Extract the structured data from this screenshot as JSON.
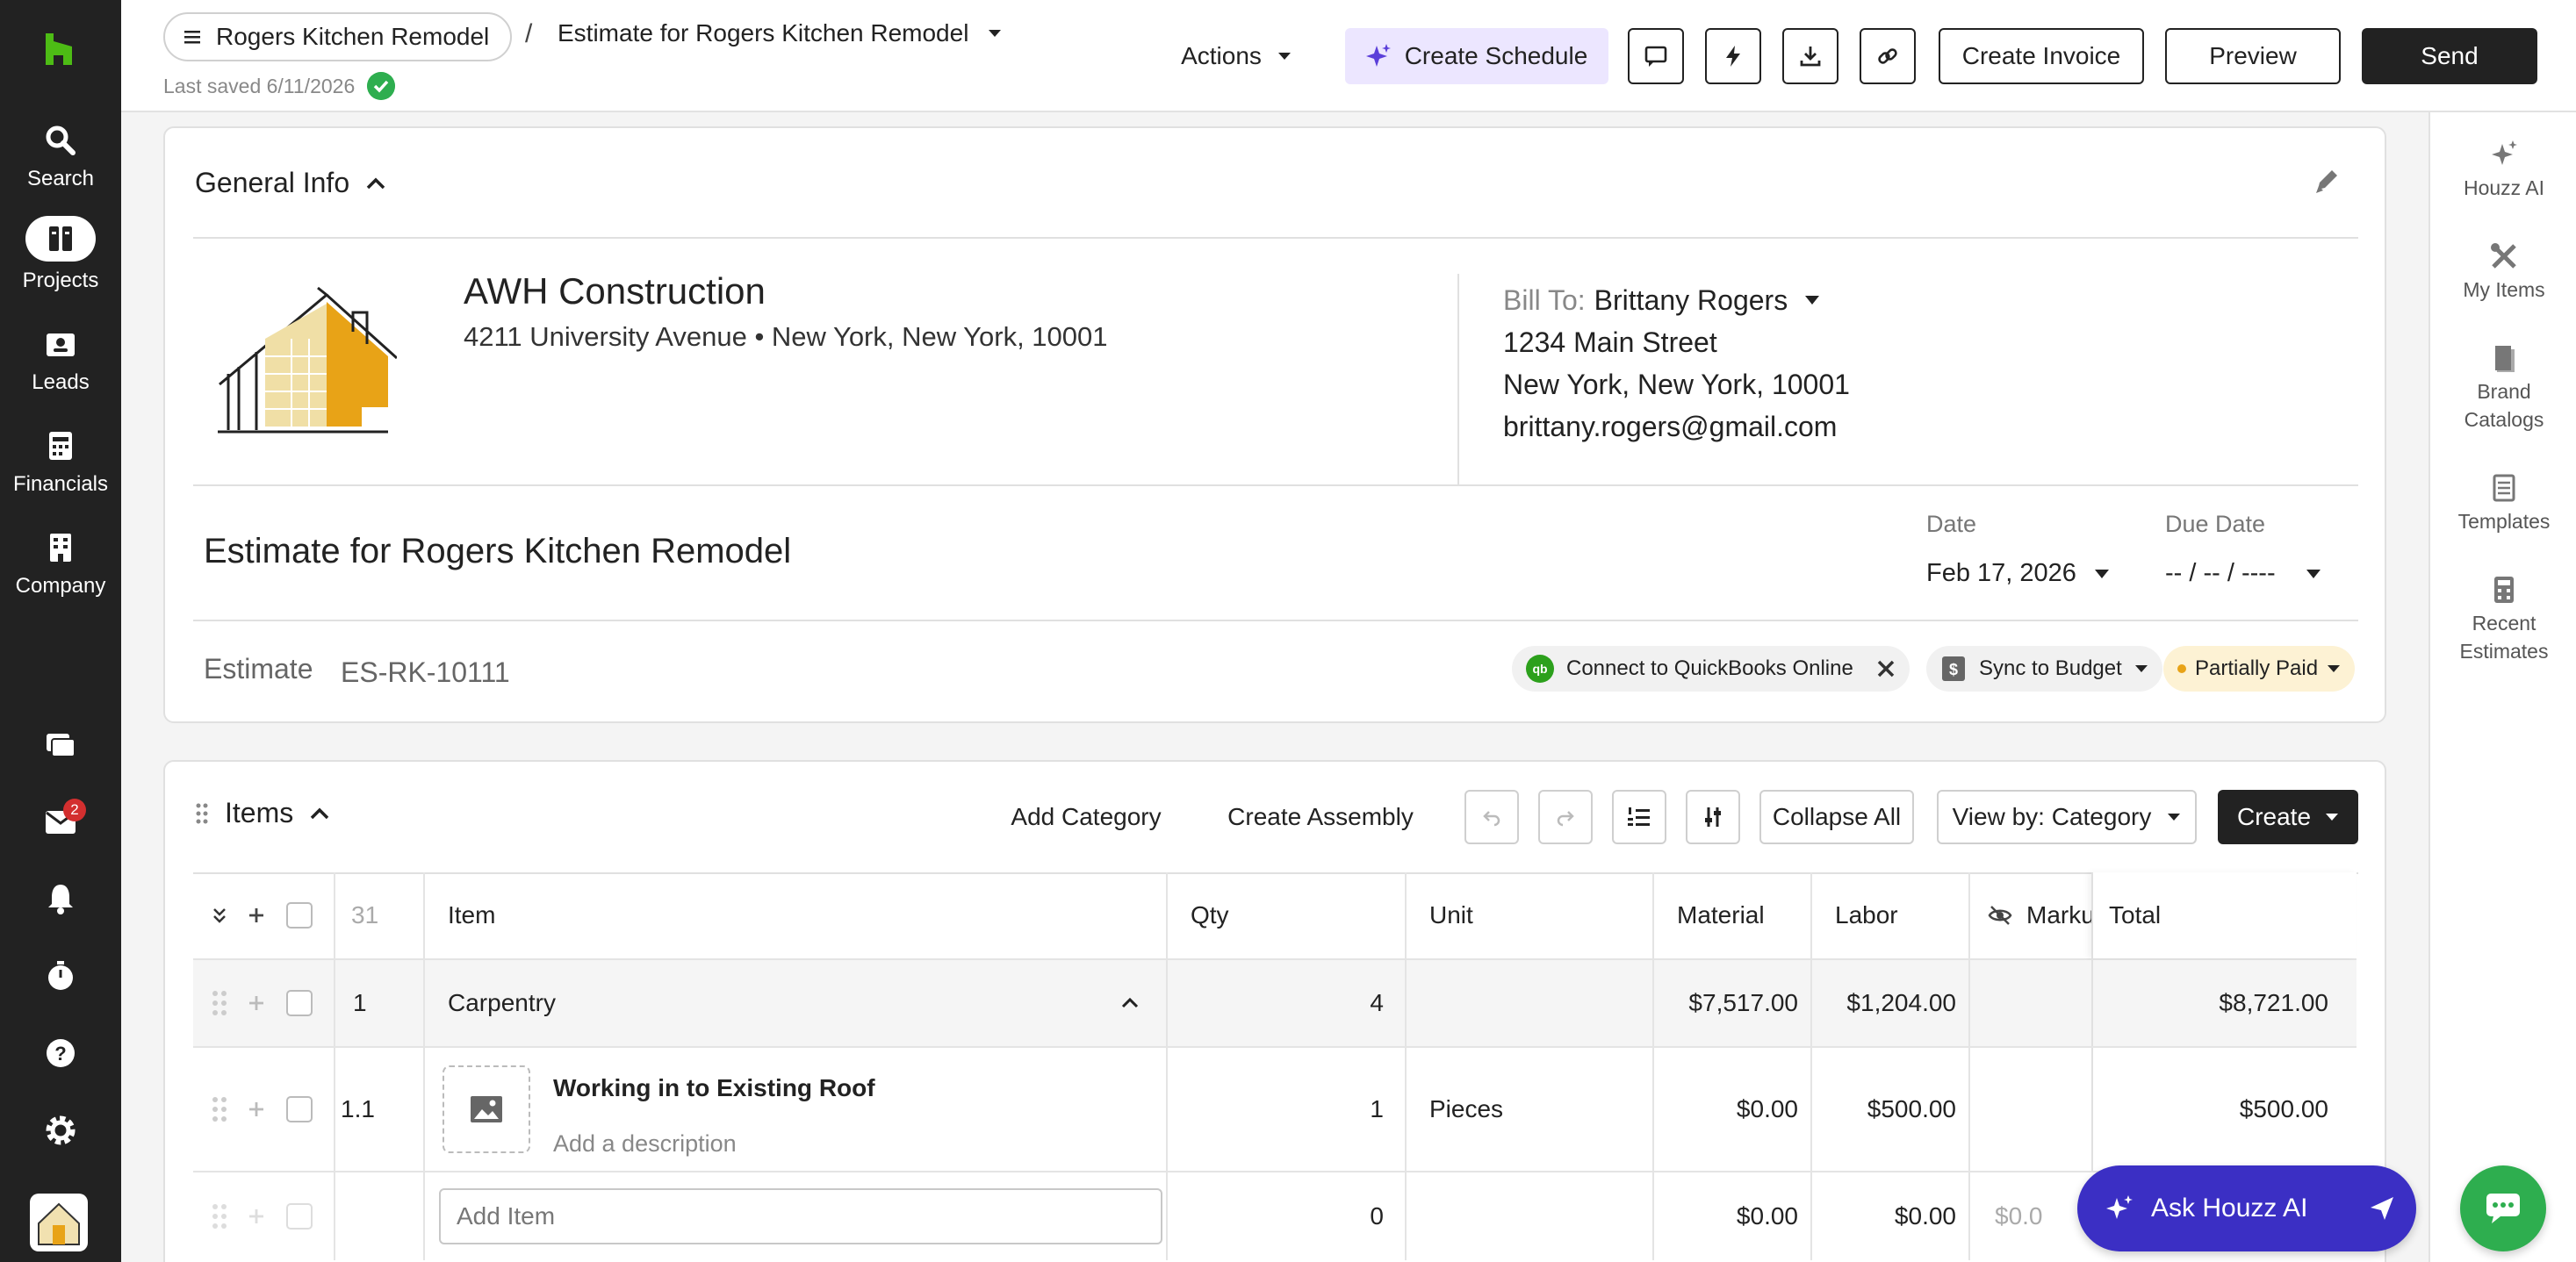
{
  "nav": {
    "items": [
      {
        "label": "Search",
        "icon": "search-icon"
      },
      {
        "label": "Projects",
        "icon": "projects-icon"
      },
      {
        "label": "Leads",
        "icon": "leads-icon"
      },
      {
        "label": "Financials",
        "icon": "financials-icon"
      },
      {
        "label": "Company",
        "icon": "company-icon"
      }
    ],
    "messages_badge": "2"
  },
  "header": {
    "project": "Rogers Kitchen Remodel",
    "separator": "/",
    "document": "Estimate for Rogers Kitchen Remodel",
    "last_saved": "Last saved 6/11/2026",
    "actions": "Actions",
    "create_schedule": "Create Schedule",
    "create_invoice": "Create Invoice",
    "preview": "Preview",
    "send": "Send"
  },
  "rail": {
    "items": [
      {
        "label": "Houzz AI",
        "icon": "sparkle-icon"
      },
      {
        "label": "My Items",
        "icon": "tools-icon"
      },
      {
        "label": "Brand Catalogs",
        "icon": "catalog-icon"
      },
      {
        "label": "Templates",
        "icon": "template-icon"
      },
      {
        "label": "Recent Estimates",
        "icon": "calculator-icon"
      }
    ]
  },
  "general": {
    "title": "General Info",
    "company": {
      "name": "AWH Construction",
      "address": "4211 University Avenue  •  New York, New York, 10001"
    },
    "bill_to": {
      "label": "Bill To:",
      "name": "Brittany Rogers",
      "street": "1234 Main Street",
      "city": "New York, New York, 10001",
      "email": "brittany.rogers@gmail.com"
    },
    "estimate_title": "Estimate for Rogers Kitchen Remodel",
    "date_label": "Date",
    "date_value": "Feb 17, 2026",
    "due_label": "Due Date",
    "due_value": "-- / -- / ----",
    "estimate_label": "Estimate",
    "estimate_number": "ES-RK-10111",
    "quickbooks": "Connect to QuickBooks Online",
    "sync": "Sync to Budget",
    "status": "Partially Paid",
    "colors": {
      "status_bg": "#fdf2d4",
      "status_dot": "#e8a317"
    }
  },
  "items": {
    "title": "Items",
    "add_category": "Add Category",
    "create_assembly": "Create Assembly",
    "collapse_all": "Collapse All",
    "view_by": "View by: Category",
    "create": "Create",
    "columns": {
      "count": "31",
      "item": "Item",
      "qty": "Qty",
      "unit": "Unit",
      "material": "Material",
      "labor": "Labor",
      "markup": "Marku",
      "total": "Total"
    },
    "category_row": {
      "index": "1",
      "name": "Carpentry",
      "qty": "4",
      "material": "$7,517.00",
      "labor": "$1,204.00",
      "total": "$8,721.00"
    },
    "item_row": {
      "index": "1.1",
      "name": "Working in to Existing Roof",
      "description_placeholder": "Add a description",
      "qty": "1",
      "unit": "Pieces",
      "material": "$0.00",
      "labor": "$500.00",
      "total": "$500.00"
    },
    "new_row": {
      "placeholder": "Add Item",
      "qty": "0",
      "material": "$0.00",
      "labor": "$0.00",
      "markup": "$0.0"
    }
  },
  "assistant": {
    "ask": "Ask Houzz AI"
  }
}
